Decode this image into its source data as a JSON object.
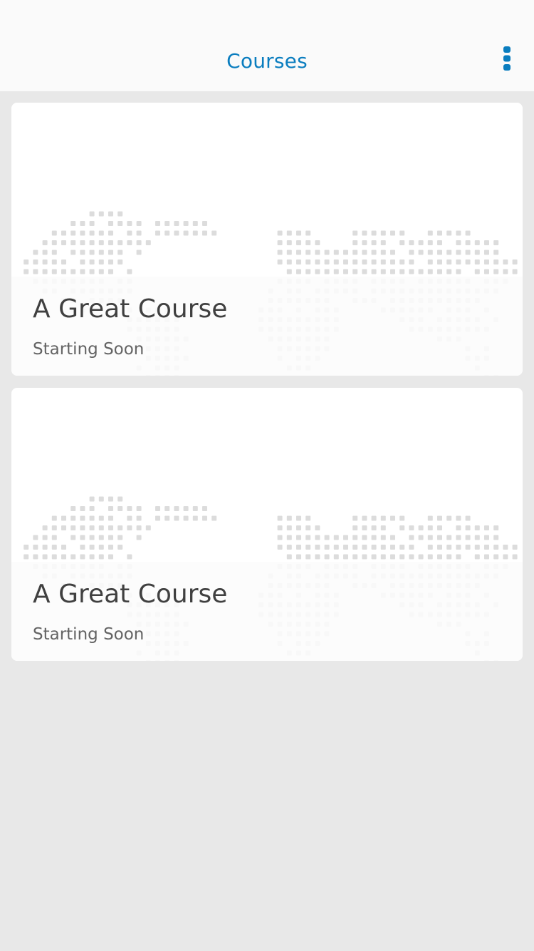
{
  "header": {
    "title": "Courses",
    "menu_icon": "more-vertical-icon",
    "accent_color": "#0a7dbf"
  },
  "courses": [
    {
      "title": "A Great Course",
      "status": "Starting Soon",
      "image_icon": "world-map-icon"
    },
    {
      "title": "A Great Course",
      "status": "Starting Soon",
      "image_icon": "world-map-icon"
    }
  ]
}
